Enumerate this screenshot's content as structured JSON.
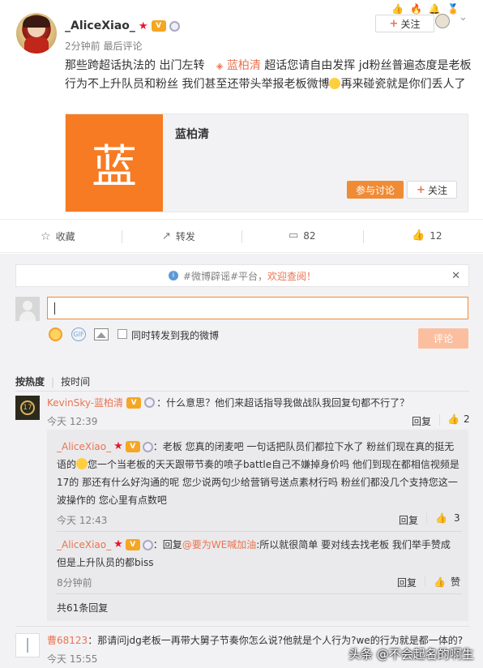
{
  "post": {
    "username": "_AliceXiao_",
    "time": "2分钟前",
    "time_suffix": "最后评论",
    "follow_label": "关注",
    "body_line1_a": "那些跨超话执法的 出门左转",
    "topic_link": "蓝柏清",
    "body_line1_b": "超话您请自由发挥 jd粉丝普遍态度是老板",
    "body_line2_a": "行为不上升队员和粉丝 我们甚至还带头举报老板微博",
    "body_line2_b": "再来碰瓷就是你们丢人了"
  },
  "card": {
    "logo_char": "蓝",
    "title": "蓝柏清",
    "join_label": "参与讨论",
    "follow_label": "关注",
    "accent": "#f77b22"
  },
  "actions": {
    "collect": "收藏",
    "repost": "转发",
    "comment": "82",
    "like": "12"
  },
  "notice": {
    "prefix": "#微博辟谣#平台，",
    "highlight": "欢迎查阅！"
  },
  "composer": {
    "repost_check_label": "同时转发到我的微博",
    "submit_label": "评论"
  },
  "sort": {
    "hot": "按热度",
    "time": "按时间"
  },
  "comments": [
    {
      "user": "KevinSky-蓝柏清",
      "text": "：什么意思？他们来超话指导我做战队我回复句都不行了？",
      "time": "今天 12:39",
      "reply_label": "回复",
      "likes": "2"
    }
  ],
  "replies": [
    {
      "user": "_AliceXiao_",
      "line1": "：老板 您真的闭麦吧 一句话把队员们都拉下水了 粉丝们现在真的挺无",
      "line2": "语的",
      "line2b": "您一个当老板的天天跟带节奏的喷子battle自己不嫌掉身价吗 他们到现在都相信视频是",
      "line3": "17的 那还有什么好沟通的呢 您少说两句少给营销号送点素材行吗 粉丝们都没几个支持您这一",
      "line4": "波操作的 您心里有点数吧",
      "time": "今天 12:43",
      "reply_label": "回复",
      "likes": "3"
    },
    {
      "user": "_AliceXiao_",
      "prefix": "：回复",
      "mention": "@要为WE喊加油",
      "line1": ":所以就很简单 要对线去找老板 我们举手赞成",
      "line2": "但是上升队员的都biss",
      "time": "8分钟前",
      "reply_label": "回复",
      "likes": "赞"
    }
  ],
  "more_replies": "共61条回复",
  "bottom_comment": {
    "user": "曹68123",
    "text": "：那请问jdg老板一再带大舅子节奏你怎么说?他就是个人行为?we的行为就是都一体的?",
    "time": "今天 15:55"
  },
  "watermark": "头条 @不会起名的啊生"
}
